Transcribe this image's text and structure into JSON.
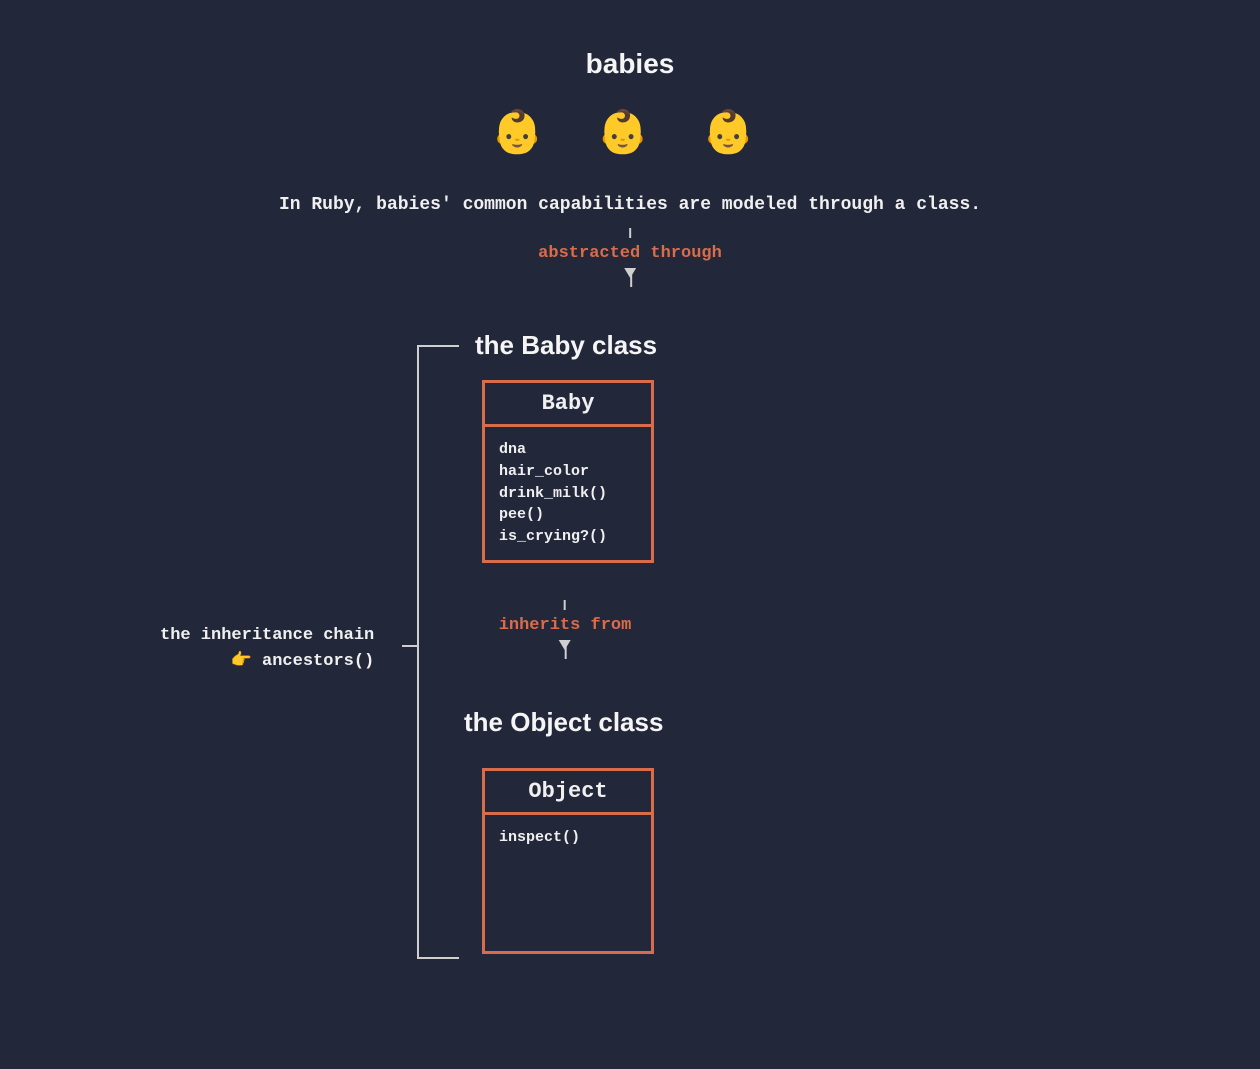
{
  "title": "babies",
  "emojis": "👶 👶 👶",
  "description": "In Ruby, babies' common capabilities are modeled through a class.",
  "arrow1_label": "abstracted through",
  "baby_heading": "the Baby class",
  "baby_class": {
    "name": "Baby",
    "members": [
      "dna",
      "hair_color",
      "drink_milk()",
      "pee()",
      "is_crying?()"
    ]
  },
  "arrow2_label": "inherits from",
  "object_heading": "the Object class",
  "object_class": {
    "name": "Object",
    "members": [
      "inspect()"
    ]
  },
  "inheritance": {
    "line1": "the inheritance chain",
    "emoji": "👉",
    "method": "ancestors()"
  },
  "colors": {
    "background": "#222739",
    "accent": "#d96c4a",
    "text": "#f0f0f0"
  }
}
